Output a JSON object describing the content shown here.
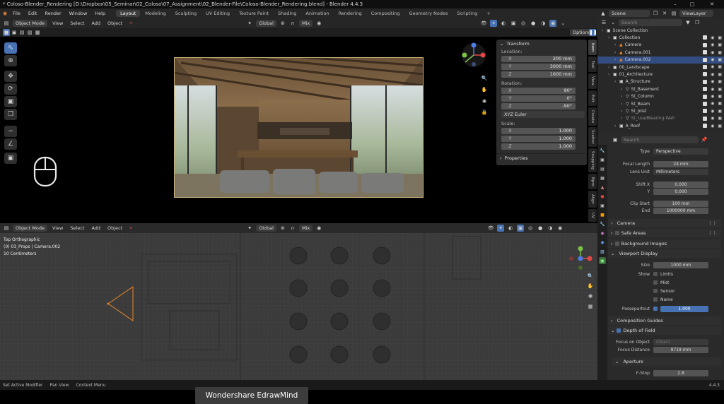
{
  "window": {
    "title": "* Coloso-Blender_Rendering [D:\\Dropbox\\05_Seminar\\02_Coloso\\07_Assignment\\02_Blender-File\\Coloso-Blender_Rendering.blend] - Blender 4.4.3"
  },
  "menubar": {
    "items": [
      "File",
      "Edit",
      "Render",
      "Window",
      "Help"
    ],
    "workspaces": [
      "Layout",
      "Modeling",
      "Sculpting",
      "UV Editing",
      "Texture Paint",
      "Shading",
      "Animation",
      "Rendering",
      "Compositing",
      "Geometry Nodes",
      "Scripting"
    ],
    "active_workspace": "Layout",
    "add_tab": "+"
  },
  "scene": {
    "label": "Scene",
    "view_layer": "ViewLayer"
  },
  "viewport_top": {
    "mode": "Object Mode",
    "menus": [
      "View",
      "Select",
      "Add",
      "Object"
    ],
    "orientation": "Global",
    "shading_mix": "Mix",
    "options": "Options",
    "transform": {
      "header": "Transform",
      "location_label": "Location:",
      "location": [
        {
          "axis": "X",
          "value": "200 mm"
        },
        {
          "axis": "Y",
          "value": "3000 mm"
        },
        {
          "axis": "Z",
          "value": "1600 mm"
        }
      ],
      "rotation_label": "Rotation:",
      "rotation": [
        {
          "axis": "X",
          "value": "90°"
        },
        {
          "axis": "Y",
          "value": "0°"
        },
        {
          "axis": "Z",
          "value": "-90°"
        }
      ],
      "rotation_mode": "XYZ Euler",
      "scale_label": "Scale:",
      "scale": [
        {
          "axis": "X",
          "value": "1.000"
        },
        {
          "axis": "Y",
          "value": "1.000"
        },
        {
          "axis": "Z",
          "value": "1.000"
        }
      ],
      "properties": "Properties"
    },
    "side_tabs": [
      "Item",
      "Tool",
      "View",
      "Edit",
      "Create",
      "Scatter",
      "Snapping",
      "Bpro",
      "Align",
      "UV"
    ]
  },
  "viewport_bottom": {
    "mode": "Object Mode",
    "menus": [
      "View",
      "Select",
      "Add",
      "Object"
    ],
    "orientation": "Global",
    "shading_mix": "Mix",
    "overlay_lines": [
      "Top Orthographic",
      "(0) 03_Props | Camera.002",
      "10 Centimeters"
    ]
  },
  "outliner": {
    "search_placeholder": "Search",
    "rows": [
      {
        "name": "Scene Collection",
        "indent": 0
      },
      {
        "name": "Collection",
        "indent": 1
      },
      {
        "name": "Camera",
        "indent": 2
      },
      {
        "name": "Camera.001",
        "indent": 2
      },
      {
        "name": "Camera.002",
        "indent": 2,
        "selected": true
      },
      {
        "name": "00_Landscape",
        "indent": 1
      },
      {
        "name": "01_Architecture",
        "indent": 1
      },
      {
        "name": "A_Structure",
        "indent": 2
      },
      {
        "name": "St_Basement",
        "indent": 3
      },
      {
        "name": "St_Column",
        "indent": 3
      },
      {
        "name": "St_Beam",
        "indent": 3
      },
      {
        "name": "St_Joist",
        "indent": 3
      },
      {
        "name": "St_LoadBearing-Wall",
        "indent": 3
      },
      {
        "name": "A_Roof",
        "indent": 2
      }
    ]
  },
  "properties": {
    "search_placeholder": "Search",
    "type_label": "Type",
    "type_value": "Perspective",
    "focal_label": "Focal Length",
    "focal_value": "24 mm",
    "lens_unit_label": "Lens Unit",
    "lens_unit_value": "Millimeters",
    "shift_x_label": "Shift X",
    "shift_x_value": "0.000",
    "shift_y_label": "Y",
    "shift_y_value": "0.000",
    "clip_start_label": "Clip Start",
    "clip_start_value": "100 mm",
    "clip_end_label": "End",
    "clip_end_value": "1000000 mm",
    "sections": {
      "camera": "Camera",
      "safe_areas": "Safe Areas",
      "background_images": "Background Images",
      "viewport_display": "Viewport Display",
      "composition_guides": "Composition Guides",
      "depth_of_field": "Depth of Field",
      "aperture": "Aperture"
    },
    "size_label": "Size",
    "size_value": "1000 mm",
    "show_label": "Show",
    "show_options": [
      "Limits",
      "Mist",
      "Sensor",
      "Name"
    ],
    "passepartout_label": "Passepartout",
    "passepartout_value": "1.000",
    "focus_object_label": "Focus on Object",
    "focus_object_placeholder": "Object",
    "focus_distance_label": "Focus Distance",
    "focus_distance_value": "9719 mm",
    "fstop_label": "F-Stop",
    "fstop_value": "2.8"
  },
  "statusbar": {
    "items": [
      "Set Active Modifier",
      "Pan View",
      "Context Menu"
    ],
    "version": "4.4.3"
  },
  "overlay": {
    "watermark": "Wondershare EdrawMind"
  },
  "colors": {
    "accent": "#4772b3",
    "selected_row": "#334d80",
    "camera_orange": "#e8862a"
  }
}
